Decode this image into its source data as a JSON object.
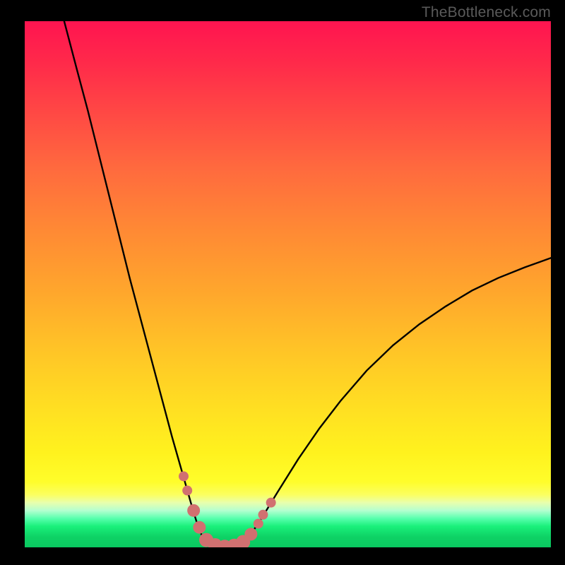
{
  "watermark": "TheBottleneck.com",
  "colors": {
    "frame": "#000000",
    "curve": "#000000",
    "marker_fill": "#d17070",
    "marker_stroke": "#b85858"
  },
  "chart_data": {
    "type": "line",
    "title": "",
    "xlabel": "",
    "ylabel": "",
    "xlim": [
      0,
      100
    ],
    "ylim": [
      0,
      100
    ],
    "series": [
      {
        "name": "left-branch",
        "x": [
          7.5,
          10,
          12,
          14,
          16,
          18,
          20,
          22,
          24,
          26,
          28,
          30,
          31,
          32,
          33,
          34
        ],
        "y": [
          100,
          90.5,
          83,
          75,
          67,
          59,
          51,
          43.5,
          36,
          28.5,
          21,
          14,
          10.5,
          7,
          3.8,
          1.5
        ]
      },
      {
        "name": "valley-floor",
        "x": [
          34,
          35,
          36,
          37,
          38,
          39,
          40,
          41,
          42,
          43
        ],
        "y": [
          1.5,
          0.6,
          0.2,
          0.05,
          0.02,
          0.05,
          0.2,
          0.6,
          1.2,
          2.5
        ]
      },
      {
        "name": "right-branch",
        "x": [
          43,
          45,
          48,
          52,
          56,
          60,
          65,
          70,
          75,
          80,
          85,
          90,
          95,
          100
        ],
        "y": [
          2.5,
          5.5,
          10.4,
          16.8,
          22.6,
          27.8,
          33.6,
          38.4,
          42.4,
          45.8,
          48.8,
          51.2,
          53.2,
          55
        ]
      }
    ],
    "markers": [
      {
        "x": 30.2,
        "y": 13.5,
        "r": 7
      },
      {
        "x": 30.9,
        "y": 10.8,
        "r": 7
      },
      {
        "x": 32.1,
        "y": 7.0,
        "r": 9
      },
      {
        "x": 33.2,
        "y": 3.8,
        "r": 9
      },
      {
        "x": 34.5,
        "y": 1.4,
        "r": 10
      },
      {
        "x": 36.2,
        "y": 0.4,
        "r": 10
      },
      {
        "x": 38.0,
        "y": 0.1,
        "r": 10
      },
      {
        "x": 39.8,
        "y": 0.3,
        "r": 10
      },
      {
        "x": 41.5,
        "y": 1.0,
        "r": 10
      },
      {
        "x": 43.0,
        "y": 2.5,
        "r": 9
      },
      {
        "x": 44.4,
        "y": 4.5,
        "r": 7
      },
      {
        "x": 45.3,
        "y": 6.2,
        "r": 7
      },
      {
        "x": 46.8,
        "y": 8.5,
        "r": 7
      }
    ],
    "gradient_note": "vertical rainbow red→orange→yellow→green representing bottleneck severity"
  }
}
